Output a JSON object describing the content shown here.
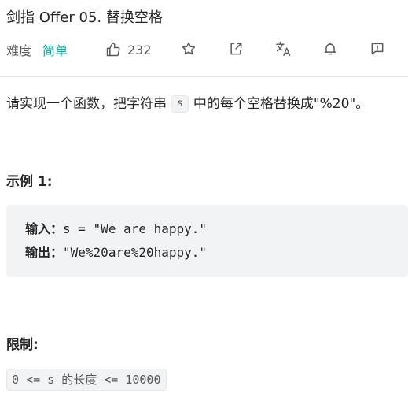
{
  "problem": {
    "title": "剑指 Offer 05. 替换空格",
    "difficulty_label": "难度",
    "difficulty": "简单",
    "likes": "232"
  },
  "toolbar": {
    "icons": [
      "thumbs-up-icon",
      "star-icon",
      "share-icon",
      "translate-icon",
      "bell-icon",
      "feedback-icon"
    ]
  },
  "description": {
    "before": "请实现一个函数，把字符串",
    "code": "s",
    "after": "中的每个空格替换成\"%20\"。"
  },
  "example": {
    "heading": "示例 1:",
    "input_label": "输入：",
    "input_value": "s = \"We are happy.\"",
    "output_label": "输出：",
    "output_value": "\"We%20are%20happy.\""
  },
  "constraints": {
    "heading": "限制:",
    "code": "0 <= s 的长度 <= 10000"
  },
  "colors": {
    "easy": "#00af9b",
    "code_bg": "#f2f3f4",
    "divider": "#e8e8e8"
  }
}
